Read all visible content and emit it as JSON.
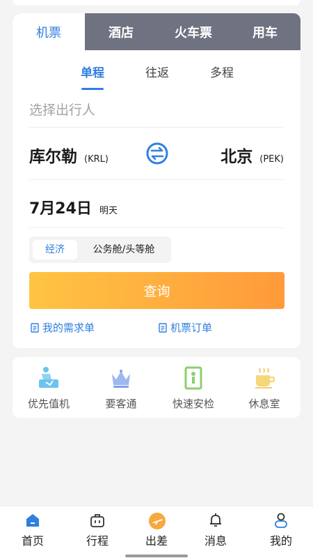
{
  "service_tabs": [
    "机票",
    "酒店",
    "火车票",
    "用车"
  ],
  "trip_tabs": [
    "单程",
    "往返",
    "多程"
  ],
  "passenger_placeholder": "选择出行人",
  "from_city": {
    "name": "库尔勒",
    "code": "(KRL)"
  },
  "to_city": {
    "name": "北京",
    "code": "(PEK)"
  },
  "date": {
    "main": "7月24日",
    "sub": "明天"
  },
  "cabin": {
    "economy": "经济",
    "business": "公务舱/头等舱"
  },
  "search_label": "查询",
  "links": {
    "my_requests": "我的需求单",
    "flight_orders": "机票订单"
  },
  "services": [
    "优先值机",
    "要客通",
    "快速安检",
    "休息室"
  ],
  "nav": [
    "首页",
    "行程",
    "出差",
    "消息",
    "我的"
  ],
  "colors": {
    "accent": "#2f7fe0",
    "tab_bar": "#6f7280",
    "button_start": "#ffc443",
    "button_end": "#ff9a3a"
  }
}
